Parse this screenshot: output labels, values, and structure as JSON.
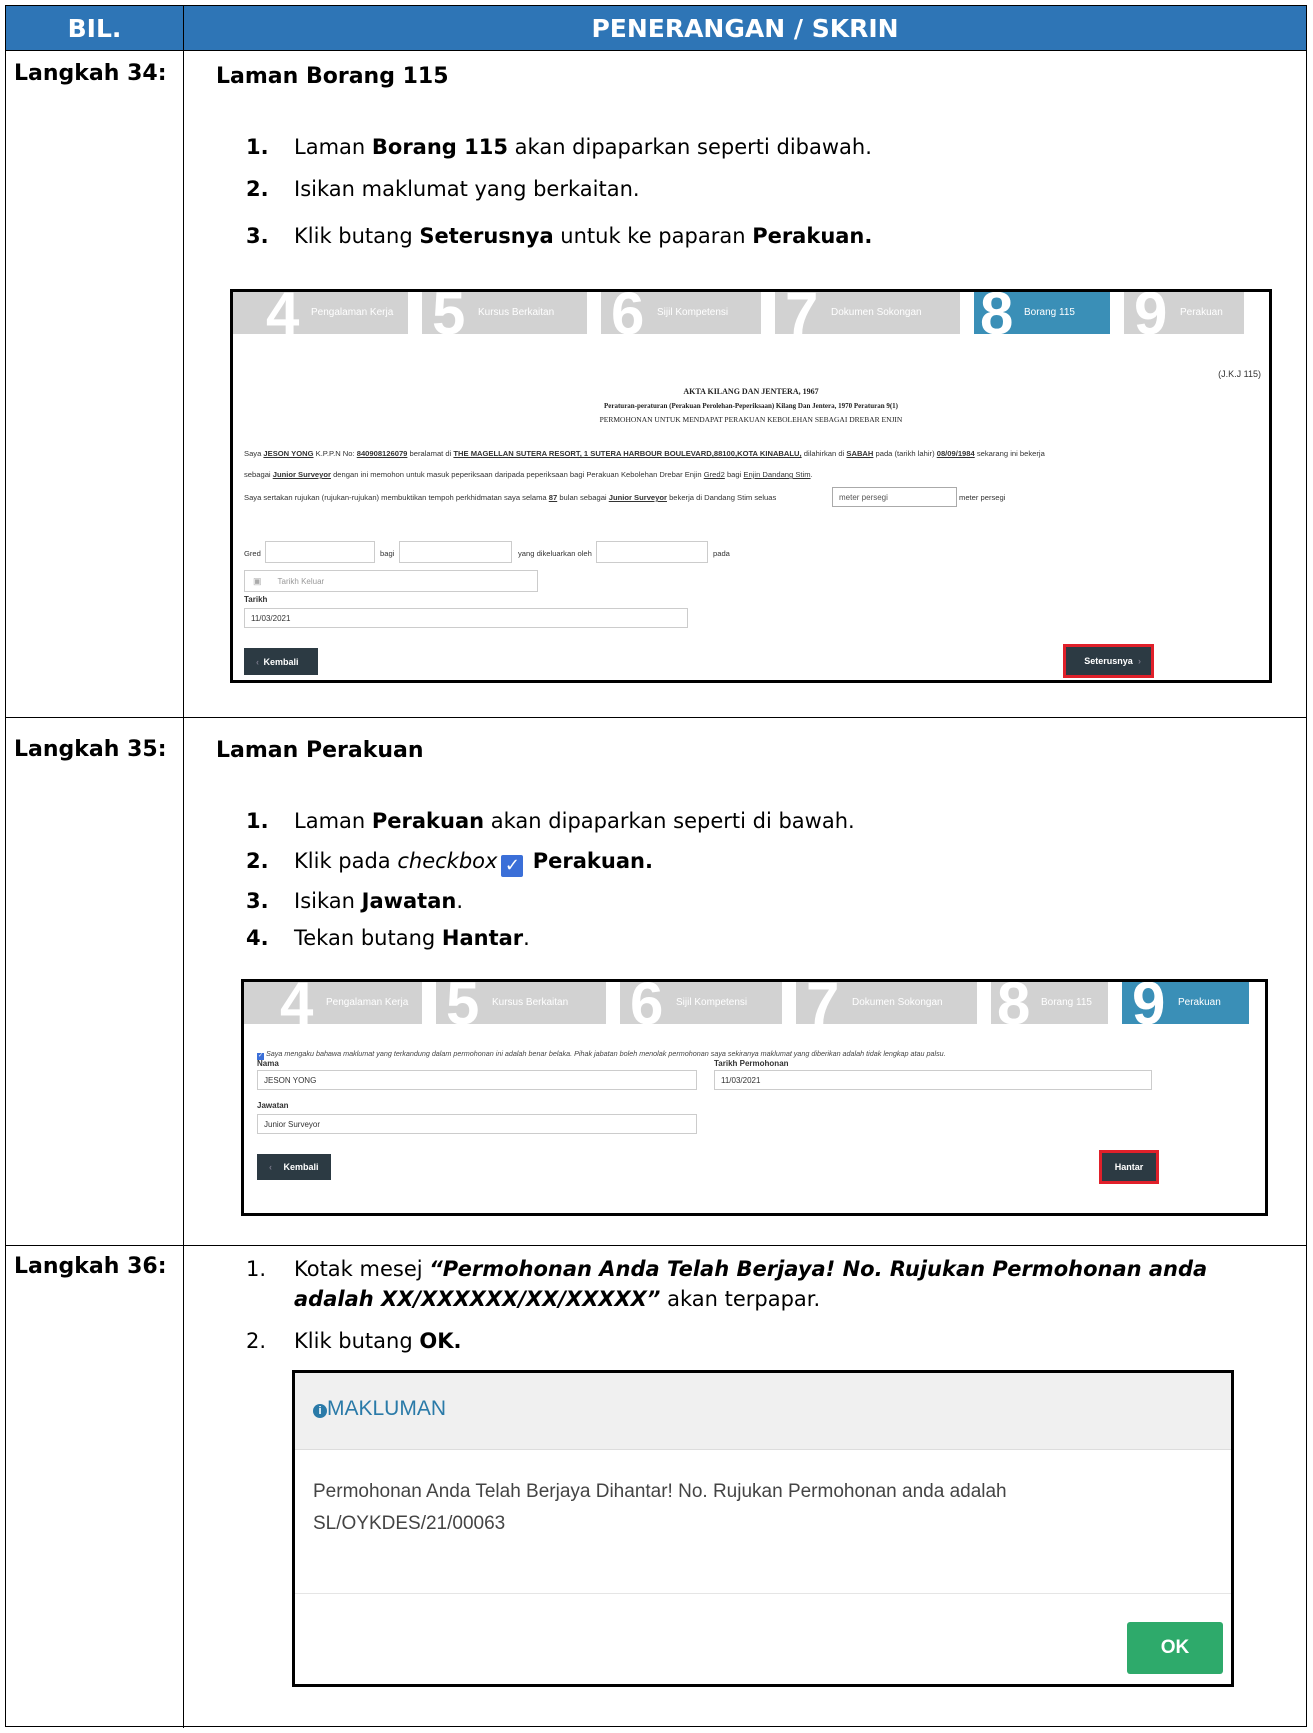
{
  "table": {
    "col1_header": "BIL.",
    "col2_header": "PENERANGAN / SKRIN"
  },
  "step34": {
    "label": "Langkah 34:",
    "title": "Laman Borang 115",
    "item1_pre": "Laman ",
    "item1_bold": "Borang 115",
    "item1_post": " akan dipaparkan seperti dibawah.",
    "item2": "Isikan maklumat yang berkaitan.",
    "item3_pre": "Klik butang ",
    "item3_bold1": "Seterusnya",
    "item3_mid": " untuk ke paparan ",
    "item3_bold2": "Perakuan."
  },
  "step35": {
    "label": "Langkah 35:",
    "title": "Laman Perakuan",
    "item1_pre": "Laman ",
    "item1_bold": "Perakuan",
    "item1_post": " akan dipaparkan seperti di bawah.",
    "item2_pre": "Klik pada ",
    "item2_italic": "checkbox",
    "item2_bold": " Perakuan.",
    "item3_pre": "Isikan ",
    "item3_bold": "Jawatan",
    "item3_post": ".",
    "item4_pre": "Tekan butang ",
    "item4_bold": "Hantar",
    "item4_post": "."
  },
  "step36": {
    "label": "Langkah 36:",
    "item1_pre": "Kotak mesej ",
    "item1_bi1": "“Permohonan Anda Telah Berjaya! No. Rujukan Permohonan anda",
    "item1_bi2": "adalah XX/XXXXXX/XX/XXXXX”",
    "item1_post": " akan terpapar.",
    "item2_pre": "Klik butang ",
    "item2_bold": "OK."
  },
  "nums": [
    "1.",
    "2.",
    "3.",
    "4."
  ],
  "tabs": [
    {
      "num": "4",
      "label": "Pengalaman Kerja"
    },
    {
      "num": "5",
      "label": "Kursus Berkaitan"
    },
    {
      "num": "6",
      "label": "Sijil Kompetensi"
    },
    {
      "num": "7",
      "label": "Dokumen Sokongan"
    },
    {
      "num": "8",
      "label": "Borang 115"
    },
    {
      "num": "9",
      "label": "Perakuan"
    }
  ],
  "form115": {
    "ref": "(J.K.J 115)",
    "act": "AKTA KILANG DAN JENTERA, 1967",
    "reg": "Peraturan-peraturan (Perakuan Perolehan-Peperiksaan) Kilang Dan Jentera, 1970 Peraturan 9(1)",
    "heading": "PERMOHONAN UNTUK MENDAPAT PERAKUAN KEBOLEHAN SEBAGAI DREBAR ENJIN",
    "p1_a": "Saya ",
    "name": "JESON YONG",
    "p1_b": " K.P.P.N No: ",
    "ic": "840908126079",
    "p1_c": " beralamat di ",
    "address": "THE MAGELLAN SUTERA RESORT, 1 SUTERA HARBOUR BOULEVARD,88100,KOTA KINABALU,",
    "p1_d": " dilahirkan di ",
    "state": "SABAH",
    "p1_e": " pada (tarikh lahir) ",
    "dob": "08/09/1984",
    "p1_f": " sekarang ini bekerja",
    "p2_a": "sebagai ",
    "job": "Junior Surveyor",
    "p2_b": " dengan ini memohon untuk masuk peperiksaan daripada peperiksaan bagi Perakuan Kebolehan Drebar Enjin ",
    "gred": "Gred2",
    "p2_c": " bagi ",
    "engine": "Enjin Dandang Stim",
    "p2_d": ".",
    "p3_a": "Saya sertakan rujukan (rujukan-rujukan) membuktikan tempoh perkhidmatan saya selama ",
    "months": "87",
    "p3_b": " bulan sebagai ",
    "job2": "Junior Surveyor",
    "p3_c": " bekerja di Dandang Stim seluas ",
    "area_placeholder": "meter persegi",
    "p3_d": " meter persegi",
    "gred_label": "Gred",
    "bagi_label": "bagi",
    "issued_label": "yang dikeluarkan oleh",
    "pada_label": "pada",
    "tarikh_keluar_placeholder": "Tarikh Keluar",
    "tarikh_label": "Tarikh",
    "tarikh_value": "11/03/2021",
    "back": "Kembali",
    "next": "Seterusnya"
  },
  "perakuan": {
    "declaration": "Saya mengaku bahawa maklumat yang terkandung dalam permohonan ini adalah benar belaka. Pihak jabatan boleh menolak permohonan saya sekiranya maklumat yang diberikan adalah tidak lengkap atau palsu.",
    "nama_label": "Nama",
    "nama_value": "JESON YONG",
    "tarikh_label": "Tarikh Permohonan",
    "tarikh_value": "11/03/2021",
    "jawatan_label": "Jawatan",
    "jawatan_value": "Junior Surveyor",
    "back": "Kembali",
    "submit": "Hantar"
  },
  "dialog": {
    "title": "MAKLUMAN",
    "message_line1": "Permohonan Anda Telah Berjaya Dihantar! No. Rujukan Permohonan anda adalah",
    "message_line2": "SL/OYKDES/21/00063",
    "ok": "OK"
  },
  "colors": {
    "header_blue": "#2e75b6",
    "tab_active": "#3a8fb7",
    "tab_inactive": "#d2d2d2",
    "button_dark": "#2c3a43",
    "highlight_red": "#e0202a",
    "ok_green": "#2eaa6b"
  }
}
